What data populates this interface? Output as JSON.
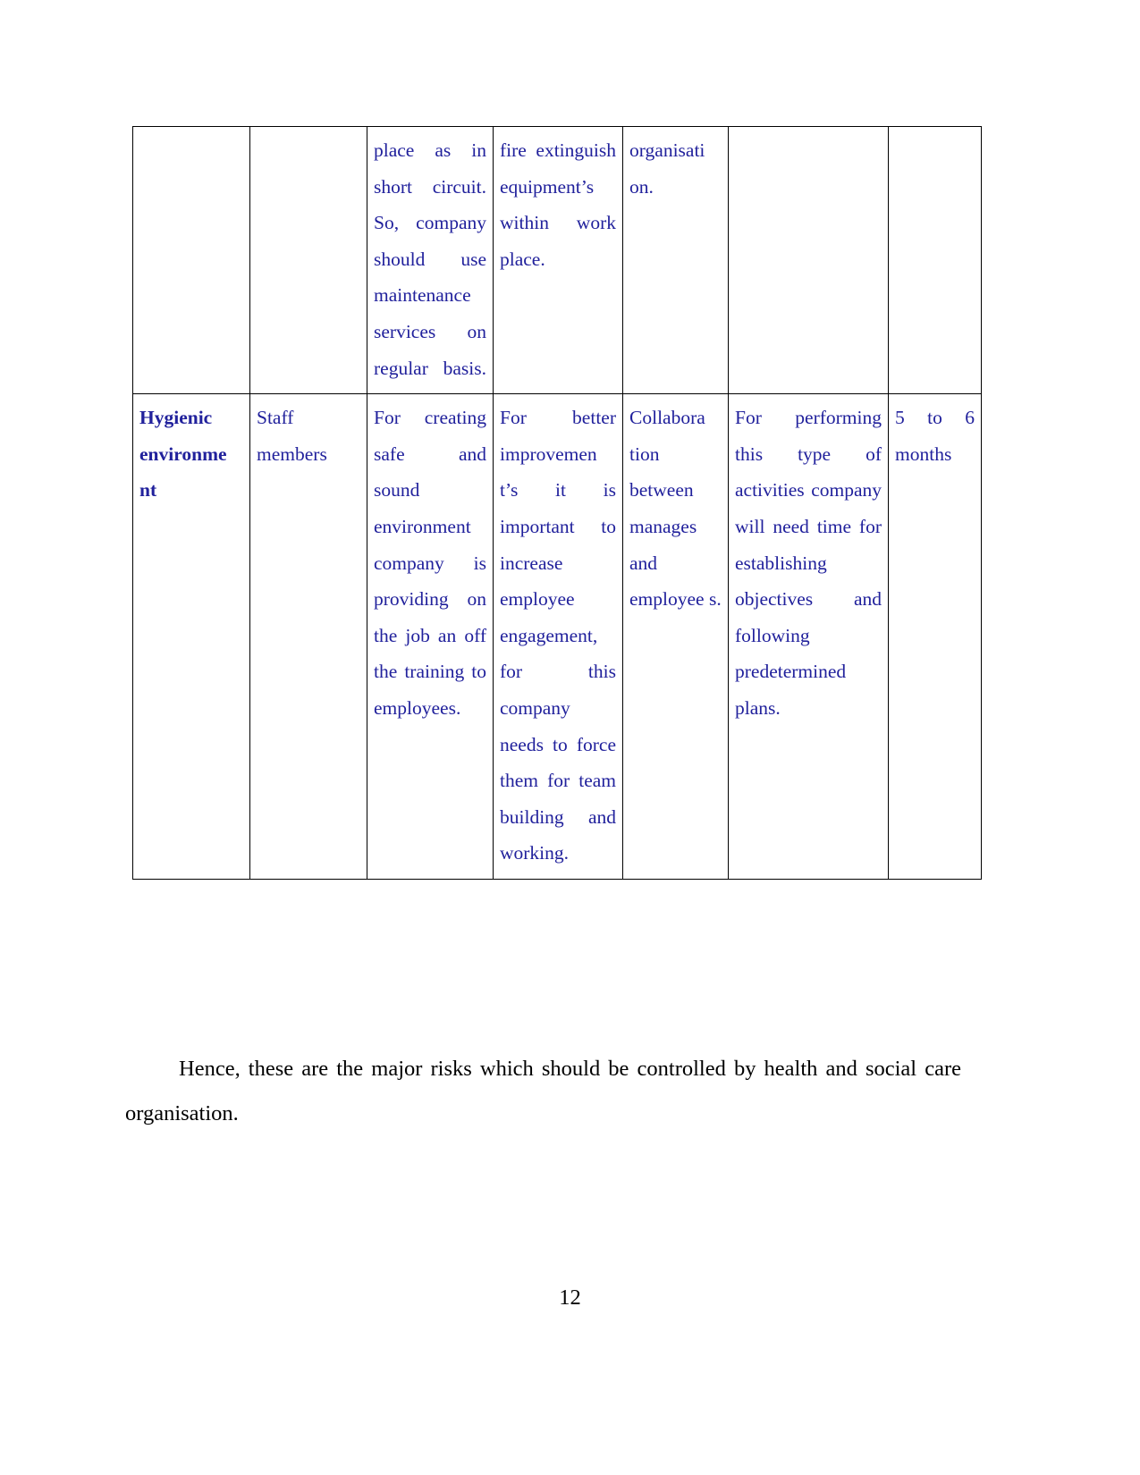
{
  "document": {
    "page_number": "12",
    "text_color_table": "#21219c",
    "text_color_body": "#000000"
  },
  "table": {
    "rows": [
      {
        "name": "row-continued-electrical-risk",
        "cells": [
          {
            "name": "risk-name",
            "text": "",
            "bold": true
          },
          {
            "name": "persons-affected",
            "text": ""
          },
          {
            "name": "existing-controls",
            "text": "place as in short circuit. So, company should use maintenance services on regular basis."
          },
          {
            "name": "further-action",
            "text": "fire extinguish equipment’s within work place."
          },
          {
            "name": "responsible-person",
            "text": "organisati on."
          },
          {
            "name": "resources-required",
            "text": ""
          },
          {
            "name": "timescale",
            "text": ""
          }
        ]
      },
      {
        "name": "row-hygienic-environment",
        "cells": [
          {
            "name": "risk-name",
            "text": "Hygienic environme nt",
            "bold": true
          },
          {
            "name": "persons-affected",
            "text": "Staff members"
          },
          {
            "name": "existing-controls",
            "text": "For creating safe and sound environment company is providing on the job an off the training to employees."
          },
          {
            "name": "further-action",
            "text": "For better improvemen t’s it is important to increase employee engagement, for this company needs to force them for team building and working."
          },
          {
            "name": "responsible-person",
            "text": "Collabora tion between manages and employee s."
          },
          {
            "name": "resources-required",
            "text": "For performing this type of activities company will need time for establishing objectives and following predetermined plans."
          },
          {
            "name": "timescale",
            "text": "5 to 6 months"
          }
        ]
      }
    ]
  },
  "closing_paragraph": {
    "text": "Hence, these are the major risks which should be controlled by health and social care organisation."
  }
}
